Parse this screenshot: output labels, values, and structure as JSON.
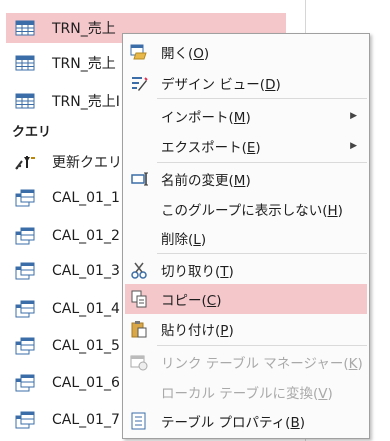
{
  "nav": {
    "tables": [
      {
        "label": "TRN_売上"
      },
      {
        "label": "TRN_売上"
      },
      {
        "label": "TRN_売上I"
      }
    ],
    "group_label": "クエリ",
    "queries": [
      {
        "label": "更新クエリ"
      },
      {
        "label": "CAL_01_1"
      },
      {
        "label": "CAL_01_2"
      },
      {
        "label": "CAL_01_3"
      },
      {
        "label": "CAL_01_4"
      },
      {
        "label": "CAL_01_5"
      },
      {
        "label": "CAL_01_6"
      },
      {
        "label": "CAL_01_7"
      }
    ]
  },
  "menu": {
    "items": [
      {
        "text": "開く(",
        "key": "O",
        "end": ")"
      },
      {
        "text": "デザイン ビュー(",
        "key": "D",
        "end": ")"
      },
      {
        "text": "インポート(",
        "key": "M",
        "end": ")"
      },
      {
        "text": "エクスポート(",
        "key": "E",
        "end": ")"
      },
      {
        "text": "名前の変更(",
        "key": "M",
        "end": ")"
      },
      {
        "text": "このグループに表示しない(",
        "key": "H",
        "end": ")"
      },
      {
        "text": "削除(",
        "key": "L",
        "end": ")"
      },
      {
        "text": "切り取り(",
        "key": "T",
        "end": ")"
      },
      {
        "text": "コピー(",
        "key": "C",
        "end": ")"
      },
      {
        "text": "貼り付け(",
        "key": "P",
        "end": ")"
      },
      {
        "text": "リンク テーブル マネージャー(",
        "key": "K",
        "end": ")"
      },
      {
        "text": "ローカル テーブルに変換(",
        "key": "V",
        "end": ")"
      },
      {
        "text": "テーブル プロパティ(",
        "key": "B",
        "end": ")"
      }
    ]
  },
  "colors": {
    "selection": "#f4c7cb",
    "disabled": "#a9a9a9"
  }
}
